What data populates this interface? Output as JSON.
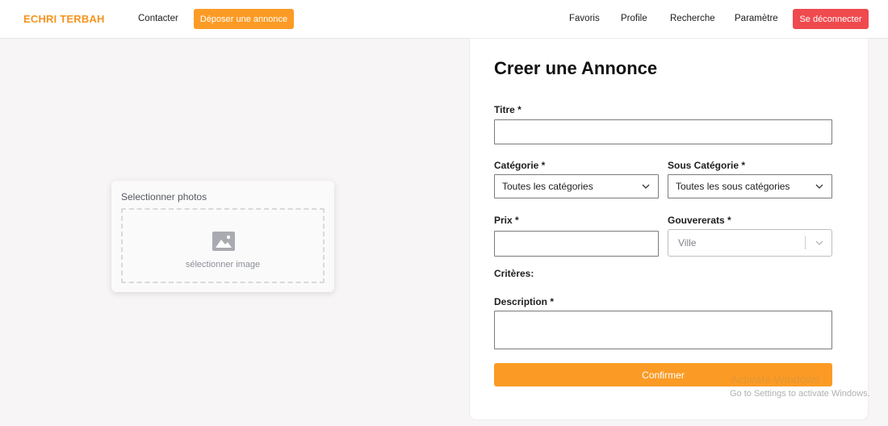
{
  "colors": {
    "brand": "#f7931e",
    "primary": "#fb9b25",
    "danger": "#ef4a4e"
  },
  "navbar": {
    "brand": "ECHRI TERBAH",
    "contact": "Contacter",
    "post_ad": "Déposer une annonce",
    "favorites": "Favoris",
    "profile": "Profile",
    "search": "Recherche",
    "settings": "Paramètre",
    "logout": "Se déconnecter"
  },
  "photos": {
    "label": "Selectionner photos",
    "dropzone_text": "sélectionner image",
    "icon": "image-icon"
  },
  "form": {
    "title": "Creer une Annonce",
    "titre_label": "Titre *",
    "titre_value": "",
    "categorie_label": "Catégorie *",
    "categorie_selected": "Toutes les catégories",
    "sous_categorie_label": "Sous Catégorie *",
    "sous_categorie_selected": "Toutes les sous catégories",
    "prix_label": "Prix *",
    "prix_value": "",
    "gouvernorats_label": "Gouvererats *",
    "gouvernorats_placeholder": "Ville",
    "criteres_label": "Critères:",
    "description_label": "Description *",
    "description_value": "",
    "confirm": "Confirmer"
  },
  "watermark": {
    "title": "Activate Windows",
    "subtitle": "Go to Settings to activate Windows."
  }
}
